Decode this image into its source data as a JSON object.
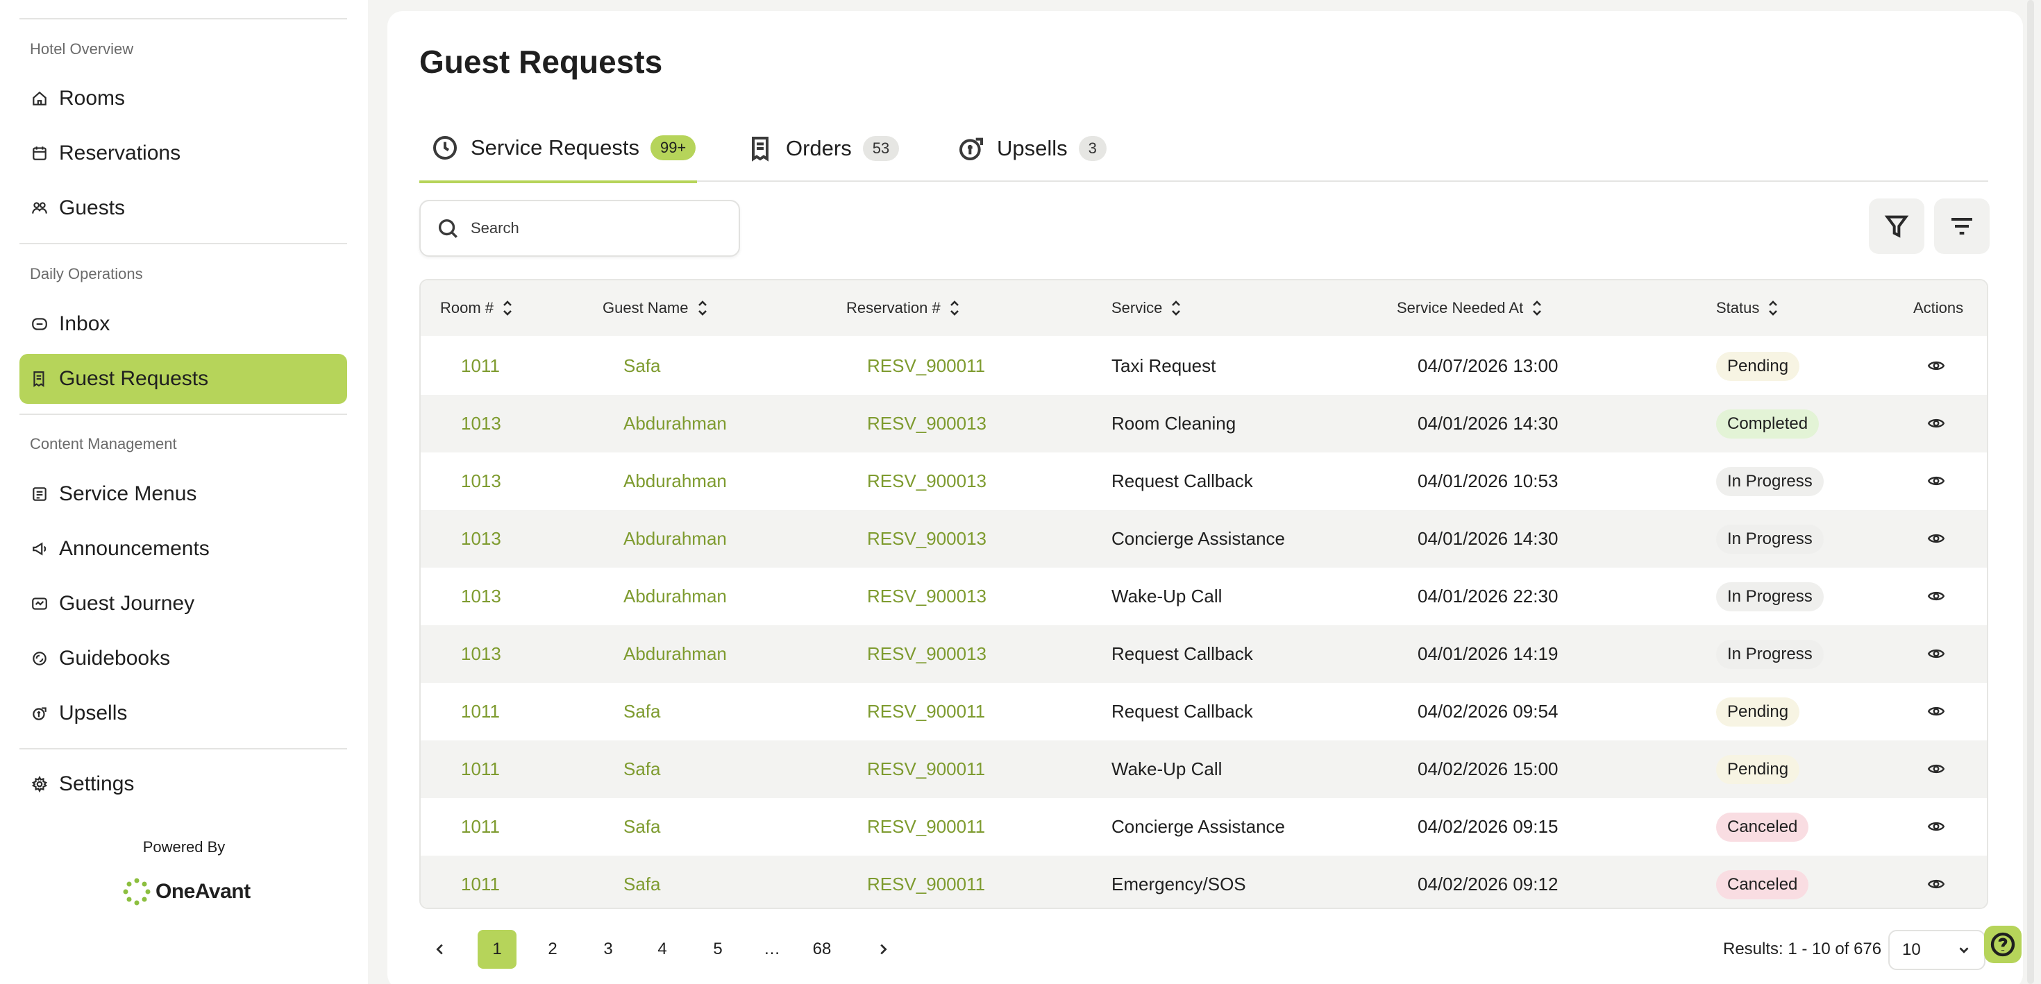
{
  "sidebar": {
    "sections": [
      "Hotel Overview",
      "Daily Operations",
      "Content Management"
    ],
    "items": [
      {
        "label": "Rooms",
        "icon": "home-icon"
      },
      {
        "label": "Reservations",
        "icon": "calendar-icon"
      },
      {
        "label": "Guests",
        "icon": "users-icon"
      },
      {
        "label": "Inbox",
        "icon": "inbox-icon"
      },
      {
        "label": "Guest Requests",
        "icon": "receipt-icon",
        "active": true
      },
      {
        "label": "Service Menus",
        "icon": "menu-book-icon"
      },
      {
        "label": "Announcements",
        "icon": "megaphone-icon"
      },
      {
        "label": "Guest Journey",
        "icon": "journey-icon"
      },
      {
        "label": "Guidebooks",
        "icon": "book-icon"
      },
      {
        "label": "Upsells",
        "icon": "upsell-icon"
      },
      {
        "label": "Settings",
        "icon": "gear-icon"
      }
    ],
    "powered_by": "Powered By",
    "brand": "OneAvant"
  },
  "page": {
    "title": "Guest Requests"
  },
  "tabs": [
    {
      "label": "Service Requests",
      "badge": "99+",
      "active": true
    },
    {
      "label": "Orders",
      "badge": "53"
    },
    {
      "label": "Upsells",
      "badge": "3"
    }
  ],
  "search": {
    "placeholder": "Search"
  },
  "table": {
    "headers": [
      "Room #",
      "Guest Name",
      "Reservation #",
      "Service",
      "Service Needed At",
      "Status",
      "Actions"
    ],
    "rows": [
      {
        "room": "1011",
        "guest": "Safa",
        "reservation": "RESV_900011",
        "service": "Taxi Request",
        "needed_at": "04/07/2026 13:00",
        "status": "Pending"
      },
      {
        "room": "1013",
        "guest": "Abdurahman",
        "reservation": "RESV_900013",
        "service": "Room Cleaning",
        "needed_at": "04/01/2026 14:30",
        "status": "Completed"
      },
      {
        "room": "1013",
        "guest": "Abdurahman",
        "reservation": "RESV_900013",
        "service": "Request Callback",
        "needed_at": "04/01/2026 10:53",
        "status": "In Progress"
      },
      {
        "room": "1013",
        "guest": "Abdurahman",
        "reservation": "RESV_900013",
        "service": "Concierge Assistance",
        "needed_at": "04/01/2026 14:30",
        "status": "In Progress"
      },
      {
        "room": "1013",
        "guest": "Abdurahman",
        "reservation": "RESV_900013",
        "service": "Wake-Up Call",
        "needed_at": "04/01/2026 22:30",
        "status": "In Progress"
      },
      {
        "room": "1013",
        "guest": "Abdurahman",
        "reservation": "RESV_900013",
        "service": "Request Callback",
        "needed_at": "04/01/2026 14:19",
        "status": "In Progress"
      },
      {
        "room": "1011",
        "guest": "Safa",
        "reservation": "RESV_900011",
        "service": "Request Callback",
        "needed_at": "04/02/2026 09:54",
        "status": "Pending"
      },
      {
        "room": "1011",
        "guest": "Safa",
        "reservation": "RESV_900011",
        "service": "Wake-Up Call",
        "needed_at": "04/02/2026 15:00",
        "status": "Pending"
      },
      {
        "room": "1011",
        "guest": "Safa",
        "reservation": "RESV_900011",
        "service": "Concierge Assistance",
        "needed_at": "04/02/2026 09:15",
        "status": "Canceled"
      },
      {
        "room": "1011",
        "guest": "Safa",
        "reservation": "RESV_900011",
        "service": "Emergency/SOS",
        "needed_at": "04/02/2026 09:12",
        "status": "Canceled"
      }
    ]
  },
  "pagination": {
    "pages": [
      "1",
      "2",
      "3",
      "4",
      "5",
      "…",
      "68"
    ],
    "current": "1",
    "results": "Results: 1 - 10 of 676",
    "per_page": "10"
  },
  "colors": {
    "accent": "#b6d45a",
    "link": "#7e9b2f",
    "pending_bg": "#f7f4e3",
    "completed_bg": "#e3f3d6",
    "inprogress_bg": "#efefed",
    "canceled_bg": "#f9dde2"
  }
}
